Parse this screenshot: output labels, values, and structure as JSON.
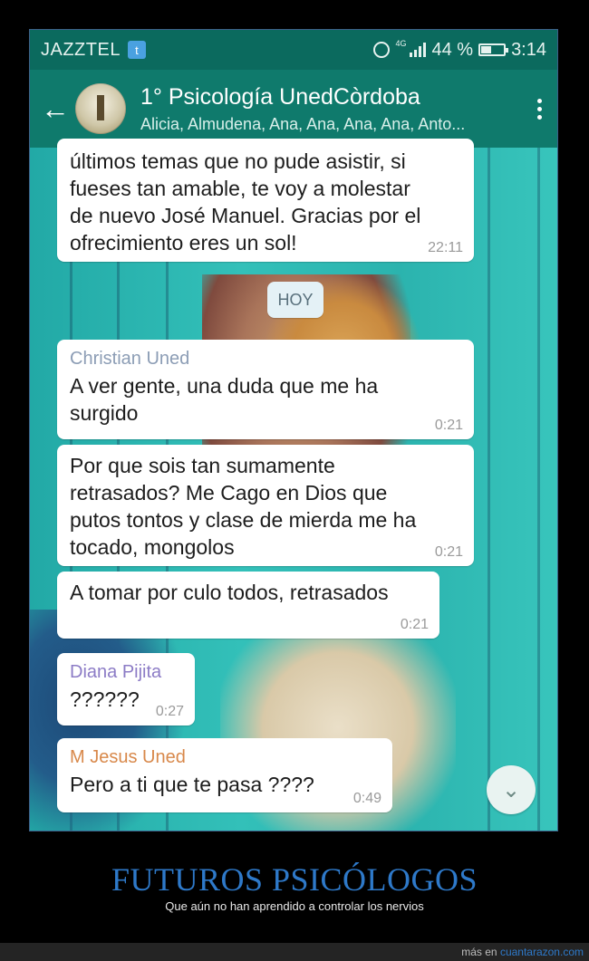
{
  "status_bar": {
    "carrier": "JAZZTEL",
    "network": "4G",
    "battery_percent": "44 %",
    "time": "3:14"
  },
  "chat_header": {
    "title": "1° Psicología UnedCòrdoba",
    "subtitle": "Alicia, Almudena, Ana, Ana, Ana, Ana, Anto..."
  },
  "messages": [
    {
      "sender": "",
      "text": "últimos temas que no pude asistir, si\nfueses tan amable, te voy a molestar\nde nuevo José Manuel. Gracias por el\nofrecimiento eres un sol!",
      "time": "22:11"
    },
    {
      "sender": "Christian Uned",
      "sender_color": "#8c9db5",
      "text": "A ver gente, una duda que me ha\nsurgido",
      "time": "0:21"
    },
    {
      "sender": "",
      "text": "Por que sois tan sumamente\nretrasados? Me Cago en Dios que\nputos tontos y clase de mierda me ha\ntocado, mongolos",
      "time": "0:21"
    },
    {
      "sender": "",
      "text": "A tomar por culo todos, retrasados",
      "time": "0:21"
    },
    {
      "sender": "Diana Pijita",
      "sender_color": "#8c7cc6",
      "text": "??????",
      "time": "0:27"
    },
    {
      "sender": "M Jesus Uned",
      "sender_color": "#d8884a",
      "text": "Pero a ti que te pasa ????",
      "time": "0:49"
    }
  ],
  "date_separator": "HOY",
  "caption": {
    "title": "FUTUROS PSICÓLOGOS",
    "subtitle": "Que aún no han aprendido a controlar los nervios"
  },
  "footer": {
    "prefix": "más en",
    "site": "cuantarazon.com"
  },
  "colors": {
    "header": "#0f7a6c",
    "status_bar": "#0b6a5e",
    "caption_blue": "#2e79c9"
  },
  "icons": {
    "back": "back-arrow-icon",
    "menu": "more-vert-icon",
    "scroll": "chevron-double-down-icon",
    "alarm": "alarm-icon",
    "signal": "signal-icon",
    "battery": "battery-icon",
    "twitter": "twitter-icon"
  }
}
